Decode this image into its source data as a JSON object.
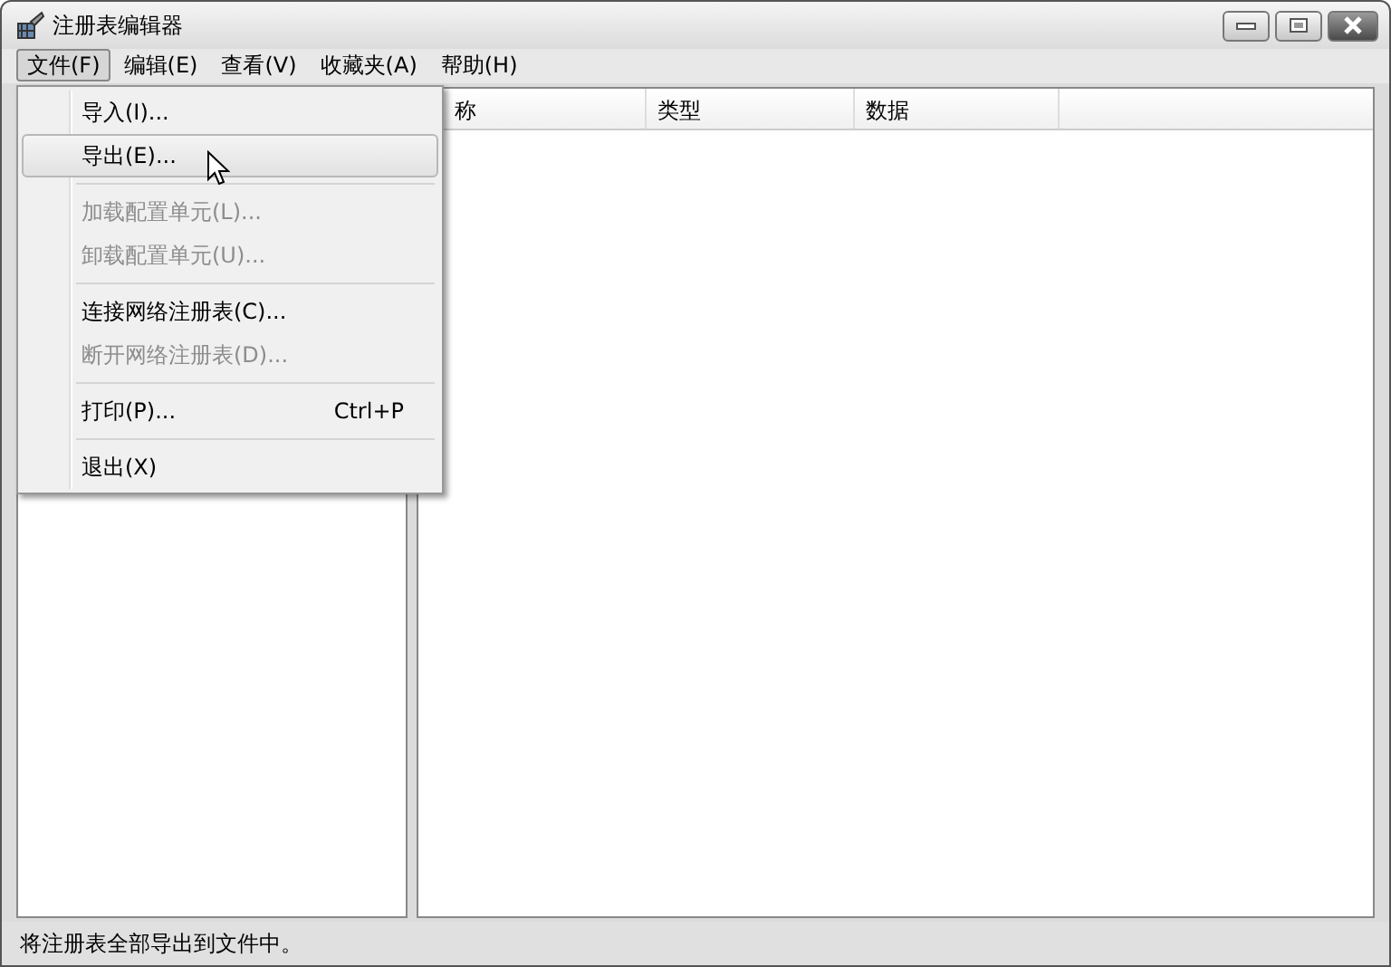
{
  "window": {
    "title": "注册表编辑器"
  },
  "menubar": [
    {
      "label": "文件(F)",
      "selected": true
    },
    {
      "label": "编辑(E)",
      "selected": false
    },
    {
      "label": "查看(V)",
      "selected": false
    },
    {
      "label": "收藏夹(A)",
      "selected": false
    },
    {
      "label": "帮助(H)",
      "selected": false
    }
  ],
  "file_menu": [
    {
      "kind": "item",
      "label": "导入(I)...",
      "disabled": false,
      "selected": false
    },
    {
      "kind": "item",
      "label": "导出(E)...",
      "disabled": false,
      "selected": true
    },
    {
      "kind": "separator"
    },
    {
      "kind": "item",
      "label": "加载配置单元(L)...",
      "disabled": true,
      "selected": false
    },
    {
      "kind": "item",
      "label": "卸载配置单元(U)...",
      "disabled": true,
      "selected": false
    },
    {
      "kind": "separator"
    },
    {
      "kind": "item",
      "label": "连接网络注册表(C)...",
      "disabled": false,
      "selected": false
    },
    {
      "kind": "item",
      "label": "断开网络注册表(D)...",
      "disabled": true,
      "selected": false
    },
    {
      "kind": "separator"
    },
    {
      "kind": "item",
      "label": "打印(P)...",
      "shortcut": "Ctrl+P",
      "disabled": false,
      "selected": false
    },
    {
      "kind": "separator"
    },
    {
      "kind": "item",
      "label": "退出(X)",
      "disabled": false,
      "selected": false
    }
  ],
  "table": {
    "columns": [
      "称",
      "类型",
      "数据"
    ]
  },
  "status_bar": "将注册表全部导出到文件中。"
}
